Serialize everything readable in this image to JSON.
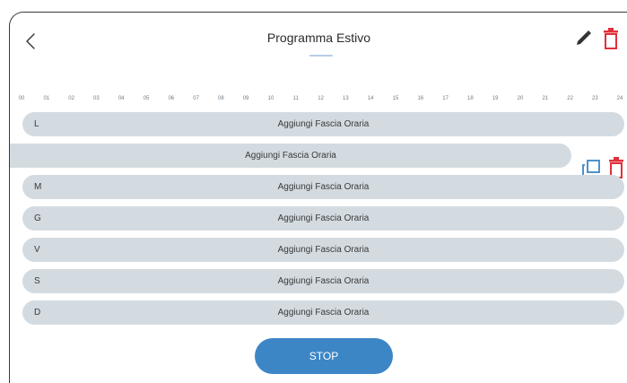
{
  "header": {
    "title": "Programma Estivo"
  },
  "hours": [
    "00",
    "01",
    "02",
    "03",
    "04",
    "05",
    "06",
    "07",
    "08",
    "09",
    "10",
    "11",
    "12",
    "13",
    "14",
    "15",
    "16",
    "17",
    "18",
    "19",
    "20",
    "21",
    "22",
    "23",
    "24"
  ],
  "days": [
    {
      "label": "L",
      "add_label": "Aggiungi Fascia Oraria"
    },
    {
      "label": "",
      "add_label": "Aggiungi Fascia Oraria"
    },
    {
      "label": "M",
      "add_label": "Aggiungi Fascia Oraria"
    },
    {
      "label": "G",
      "add_label": "Aggiungi Fascia Oraria"
    },
    {
      "label": "V",
      "add_label": "Aggiungi Fascia Oraria"
    },
    {
      "label": "S",
      "add_label": "Aggiungi Fascia Oraria"
    },
    {
      "label": "D",
      "add_label": "Aggiungi Fascia Oraria"
    }
  ],
  "footer": {
    "stop_label": "STOP"
  },
  "colors": {
    "accent": "#3d86c6",
    "danger": "#e0303a",
    "row_bg": "#d3dbe1"
  },
  "icons": {
    "back": "chevron-left-icon",
    "edit": "pencil-icon",
    "delete": "trash-icon",
    "copy": "copy-icon"
  }
}
